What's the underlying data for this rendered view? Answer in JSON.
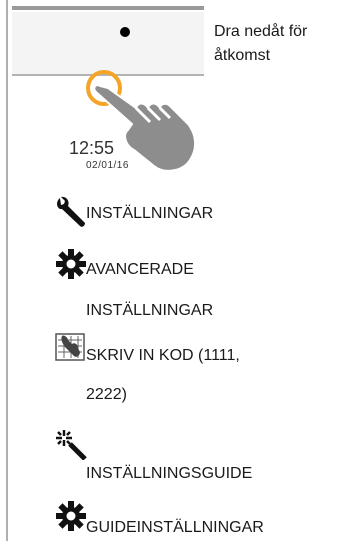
{
  "hint": {
    "line1": "Dra nedåt för",
    "line2": "åtkomst"
  },
  "illustration": {
    "time": "12:55",
    "date": "02/01/16"
  },
  "menu": [
    {
      "icon": "wrench-icon",
      "label": "INSTÄLLNINGAR"
    },
    {
      "icon": "gear-icon",
      "label": "AVANCERADE",
      "label2": "INSTÄLLNINGAR"
    },
    {
      "icon": "code-entry-icon",
      "label": "SKRIV IN KOD (1111,",
      "label2": "2222)"
    },
    {
      "icon": "magic-wand-icon",
      "label": "INSTÄLLNINGSGUIDE"
    },
    {
      "icon": "gear-icon",
      "label": "GUIDEINSTÄLLNINGAR"
    }
  ],
  "colors": {
    "accent": "#f4a426",
    "icon": "#111111",
    "divider": "#b0b0b0"
  }
}
